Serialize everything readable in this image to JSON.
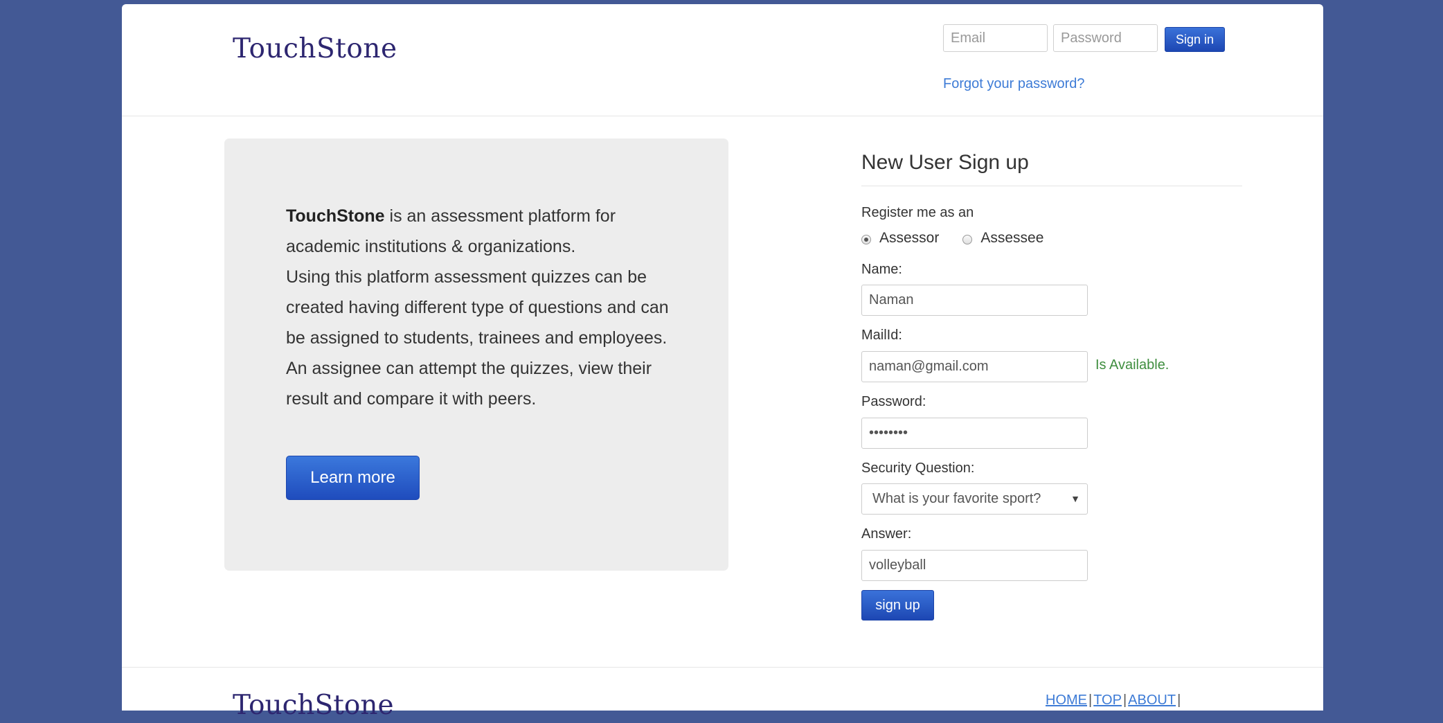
{
  "header": {
    "logo": "TouchStone",
    "email_placeholder": "Email",
    "password_placeholder": "Password",
    "signin_label": "Sign in",
    "forgot_label": "Forgot your password?"
  },
  "info": {
    "brand": "TouchStone",
    "line1": " is an assessment platform for academic institutions & organizations.",
    "line2": "Using this platform assessment quizzes can be created having different type of questions and can be assigned to students, trainees and employees. An assignee can attempt the quizzes, view their result and compare it with peers.",
    "learn_more_label": "Learn more"
  },
  "signup": {
    "title": "New User Sign up",
    "register_label": "Register me as an",
    "role_options": [
      "Assessor",
      "Assessee"
    ],
    "selected_role": "Assessor",
    "name_label": "Name:",
    "name_value": "Naman",
    "mail_label": "MailId:",
    "mail_value": "naman@gmail.com",
    "mail_status": "Is Available.",
    "password_label": "Password:",
    "password_value": "••••••••",
    "security_label": "Security Question:",
    "security_value": "What is your favorite sport?",
    "answer_label": "Answer:",
    "answer_value": "volleyball",
    "signup_label": "sign up"
  },
  "footer": {
    "logo": "TouchStone",
    "nav": [
      "HOME",
      "TOP",
      "ABOUT"
    ],
    "separator": "|"
  },
  "colors": {
    "background": "#435995",
    "brand": "#2d2670",
    "accent": "#1d47b3",
    "link": "#3d7bd6",
    "available": "#3f8e3f"
  },
  "icons": {
    "select_arrow": "chevron-down-icon"
  }
}
